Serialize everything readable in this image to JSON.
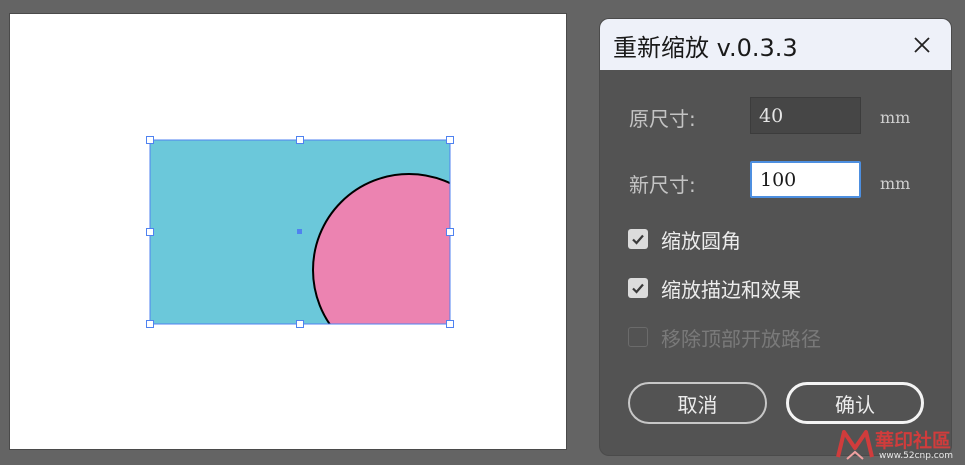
{
  "artboard": {
    "shape_fill": "#6BC8DA",
    "circle_fill": "#EC83B1",
    "selection_color": "#4F82F0"
  },
  "dialog": {
    "title": "重新缩放 v.0.3.3",
    "close_icon": "close-icon",
    "fields": {
      "original_label": "原尺寸:",
      "original_value": "40",
      "original_unit": "mm",
      "new_label": "新尺寸:",
      "new_value": "100",
      "new_unit": "mm"
    },
    "options": [
      {
        "label": "缩放圆角",
        "checked": true,
        "enabled": true
      },
      {
        "label": "缩放描边和效果",
        "checked": true,
        "enabled": true
      },
      {
        "label": "移除顶部开放路径",
        "checked": false,
        "enabled": false
      }
    ],
    "buttons": {
      "cancel": "取消",
      "ok": "确认"
    }
  },
  "watermark": {
    "text": "華印社區",
    "url": "www.52cnp.com"
  }
}
